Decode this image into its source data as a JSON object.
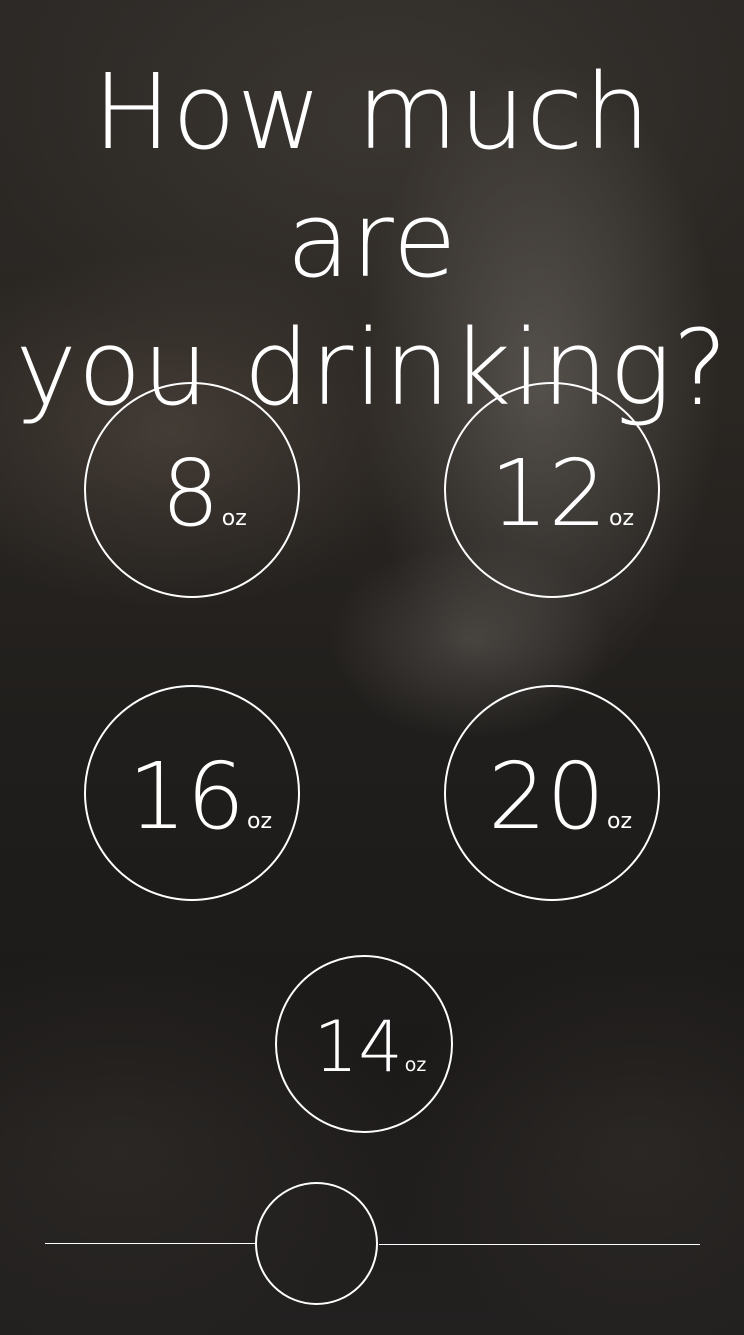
{
  "title": {
    "line1": "How much are",
    "line2": "you drinking?"
  },
  "sizes": [
    {
      "value": "8",
      "unit": "oz"
    },
    {
      "value": "12",
      "unit": "oz"
    },
    {
      "value": "16",
      "unit": "oz"
    },
    {
      "value": "20",
      "unit": "oz"
    },
    {
      "value": "14",
      "unit": "oz"
    }
  ],
  "slider": {
    "value": 0.33
  },
  "colors": {
    "foreground": "#ffffff",
    "background": "#1e1c1a"
  }
}
